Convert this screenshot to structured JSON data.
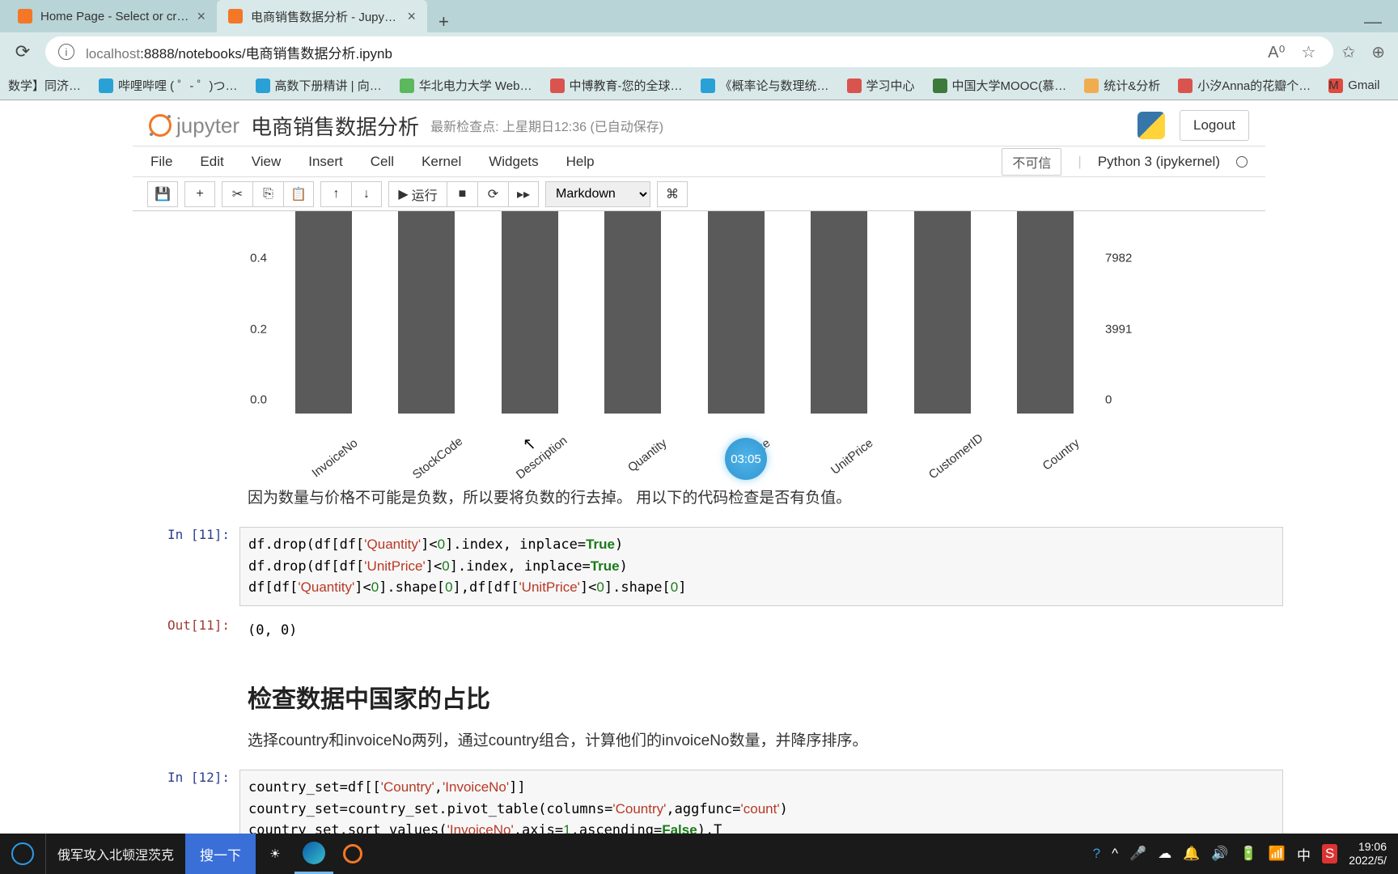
{
  "browser": {
    "tabs": [
      {
        "title": "Home Page - Select or create a n",
        "active": false
      },
      {
        "title": "电商销售数据分析 - Jupyter Note",
        "active": true
      }
    ],
    "url_host": "localhost",
    "url_rest": ":8888/notebooks/电商销售数据分析.ipynb",
    "bookmarks": [
      "数学】同济…",
      "哔哩哔哩 ( ゜- ゜)つ…",
      "高数下册精讲 | 向…",
      "华北电力大学 Web…",
      "中博教育-您的全球…",
      "《概率论与数理统…",
      "学习中心",
      "中国大学MOOC(慕…",
      "统计&分析",
      "小汐Anna的花瓣个…",
      "Gmail"
    ]
  },
  "jupyter": {
    "logo_text": "jupyter",
    "title": "电商销售数据分析",
    "checkpoint": "最新检查点: 上星期日12:36    (已自动保存)",
    "logout": "Logout",
    "menu": [
      "File",
      "Edit",
      "View",
      "Insert",
      "Cell",
      "Kernel",
      "Widgets",
      "Help"
    ],
    "trusted": "不可信",
    "kernel": "Python 3 (ipykernel)",
    "run_label": "运行",
    "cell_type": "Markdown"
  },
  "chart_data": {
    "type": "bar",
    "categories": [
      "InvoiceNo",
      "StockCode",
      "Description",
      "Quantity",
      "ceDate",
      "UnitPrice",
      "CustomerID",
      "Country"
    ],
    "values": [
      0.5,
      0.5,
      0.5,
      0.5,
      0.5,
      0.5,
      0.5,
      0.5
    ],
    "y_ticks_left": [
      "0.0",
      "0.2",
      "0.4"
    ],
    "y_ticks_right": [
      "0",
      "3991",
      "7982"
    ],
    "ylim": [
      0.0,
      0.5
    ]
  },
  "cursor_time": "03:05",
  "md1": "因为数量与价格不可能是负数，所以要将负数的行去掉。 用以下的代码检查是否有负值。",
  "cell11": {
    "in_label": "In  [11]:",
    "out_label": "Out[11]:",
    "out_value": "(0, 0)"
  },
  "heading2": "检查数据中国家的占比",
  "md2": "选择country和invoiceNo两列，通过country组合，计算他们的invoiceNo数量，并降序排序。",
  "cell12": {
    "in_label": "In  [12]:"
  },
  "taskbar": {
    "news": "俄军攻入北顿涅茨克",
    "search": "搜一下",
    "time": "19:06",
    "date": "2022/5/"
  }
}
